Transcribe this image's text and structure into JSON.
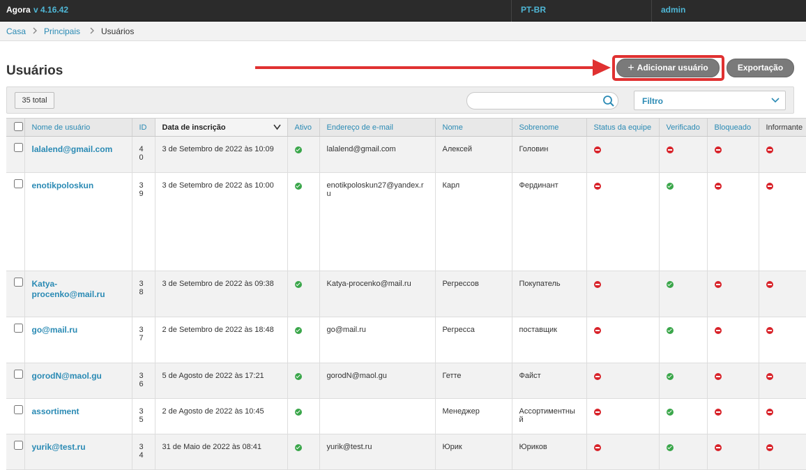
{
  "topbar": {
    "brand": "Agora",
    "version": "v 4.16.42",
    "language": "PT-BR",
    "user": "admin"
  },
  "breadcrumb": {
    "home": "Casa",
    "parent": "Principais",
    "current": "Usuários"
  },
  "page_title": "Usuários",
  "actions": {
    "add_user": "Adicionar usuário",
    "export": "Exportação"
  },
  "filters": {
    "total": "35 total",
    "search_value": "",
    "search_placeholder": "",
    "filter_label": "Filtro"
  },
  "colors": {
    "accent": "#2a8ab4",
    "ok": "#3aa64a",
    "no": "#d8232a",
    "highlight": "#e03131"
  },
  "table": {
    "columns": [
      "Nome de usuário",
      "ID",
      "Data de inscrição",
      "Ativo",
      "Endereço de e-mail",
      "Nome",
      "Sobrenome",
      "Status da equipe",
      "Verificado",
      "Bloqueado",
      "Informante"
    ],
    "rows": [
      {
        "username": "lalalend@gmail.com",
        "id": "40",
        "date": "3 de Setembro de 2022 às 10:09",
        "active": true,
        "email": "lalalend@gmail.com",
        "first": "Алексей",
        "last": "Головин",
        "staff": false,
        "verified": false,
        "blocked": false,
        "informant": false
      },
      {
        "username": "enotikpoloskun",
        "id": "39",
        "date": "3 de Setembro de 2022 às 10:00",
        "active": true,
        "email": "enotikpoloskun27@yandex.ru",
        "first": "Карл",
        "last": "Фердинант",
        "staff": false,
        "verified": true,
        "blocked": false,
        "informant": false
      },
      {
        "username": "Katya-procenko@mail.ru",
        "id": "38",
        "date": "3 de Setembro de 2022 às 09:38",
        "active": true,
        "email": "Katya-procenko@mail.ru",
        "first": "Регрессов",
        "last": "Покупатель",
        "staff": false,
        "verified": true,
        "blocked": false,
        "informant": false
      },
      {
        "username": "go@mail.ru",
        "id": "37",
        "date": "2 de Setembro de 2022 às 18:48",
        "active": true,
        "email": "go@mail.ru",
        "first": "Регресса",
        "last": "поставщик",
        "staff": false,
        "verified": true,
        "blocked": false,
        "informant": false
      },
      {
        "username": "gorodN@maol.gu",
        "id": "36",
        "date": "5 de Agosto de 2022 às 17:21",
        "active": true,
        "email": "gorodN@maol.gu",
        "first": "Гетте",
        "last": "Файст",
        "staff": false,
        "verified": true,
        "blocked": false,
        "informant": false
      },
      {
        "username": "assortiment",
        "id": "35",
        "date": "2 de Agosto de 2022 às 10:45",
        "active": true,
        "email": "",
        "first": "Менеджер",
        "last": "Ассортиментный",
        "staff": false,
        "verified": true,
        "blocked": false,
        "informant": false
      },
      {
        "username": "yurik@test.ru",
        "id": "34",
        "date": "31 de Maio de 2022 às 08:41",
        "active": true,
        "email": "yurik@test.ru",
        "first": "Юрик",
        "last": "Юриков",
        "staff": false,
        "verified": true,
        "blocked": false,
        "informant": false
      }
    ]
  }
}
